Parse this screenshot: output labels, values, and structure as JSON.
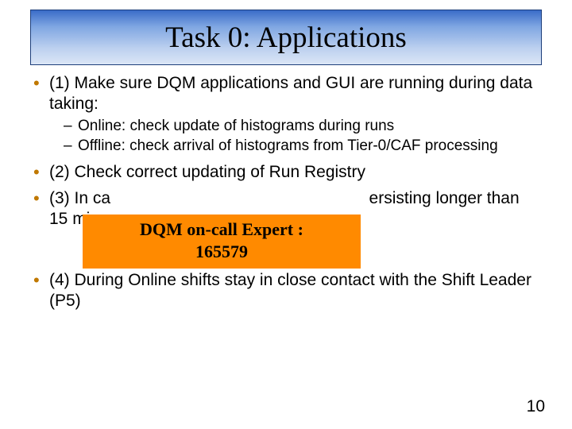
{
  "title": "Task 0: Applications",
  "bullets": {
    "b1": {
      "text": "(1) Make sure DQM applications and GUI are running during data taking:",
      "sub": {
        "s1": "Online: check update of histograms during runs",
        "s2": "Offline: check arrival of histograms from Tier-0/CAF processing"
      }
    },
    "b2": {
      "text": "(2) Check correct updating of Run Registry"
    },
    "b3": {
      "text_before": "(3) In ca",
      "text_mid": "ersisting longer than 15 mins"
    },
    "b4": {
      "text": "(4) During Online shifts stay in close contact with the Shift Leader (P5)"
    }
  },
  "callout": {
    "line1": "DQM on-call Expert :",
    "line2": "165579"
  },
  "page_number": "10"
}
